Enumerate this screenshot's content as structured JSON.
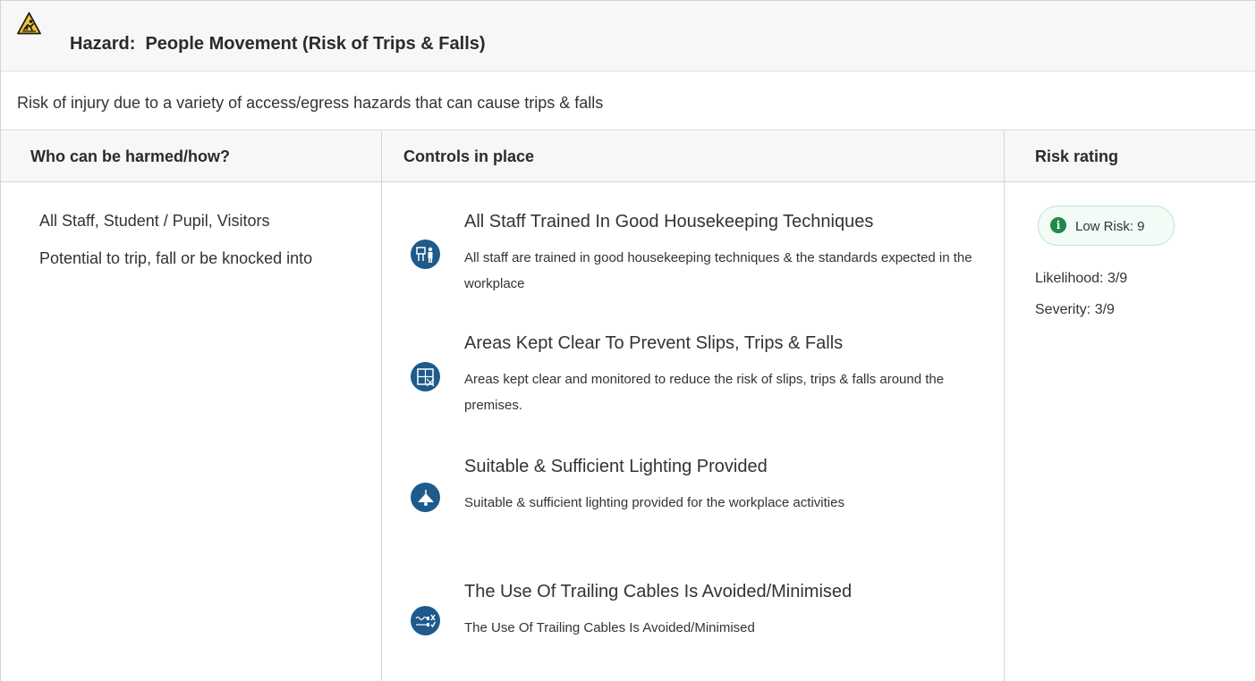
{
  "hazard": {
    "title": "Hazard:  People Movement (Risk of Trips & Falls)",
    "icon": "warning-slip-icon",
    "description": "Risk of injury due to a variety of access/egress hazards that can cause trips & falls"
  },
  "table": {
    "headers": {
      "who": "Who can be harmed/how?",
      "controls": "Controls in place",
      "risk": "Risk rating"
    }
  },
  "who": {
    "people": "All Staff, Student / Pupil, Visitors",
    "how": "Potential to trip, fall or be knocked into"
  },
  "controls": [
    {
      "title": "All Staff Trained In Good Housekeeping Techniques",
      "description": "All staff are trained in good housekeeping techniques & the standards expected in the workplace",
      "icon": "training-icon"
    },
    {
      "title": "Areas Kept Clear To Prevent Slips, Trips & Falls",
      "description": "Areas kept clear and monitored to reduce the risk of slips, trips & falls around the premises.",
      "icon": "clear-area-icon"
    },
    {
      "title": "Suitable & Sufficient Lighting Provided",
      "description": "Suitable & sufficient lighting provided for the workplace activities",
      "icon": "lamp-icon"
    },
    {
      "title": "The Use Of Trailing Cables Is Avoided/Minimised",
      "description": "The Use Of Trailing Cables Is Avoided/Minimised",
      "icon": "cable-icon"
    }
  ],
  "risk": {
    "badge": "Low Risk: 9",
    "badge_icon": "info-icon",
    "likelihood": "Likelihood: 3/9",
    "severity": "Severity: 3/9",
    "colors": {
      "low": "#1f8a47",
      "icon_bg": "#1e5a8c"
    }
  }
}
